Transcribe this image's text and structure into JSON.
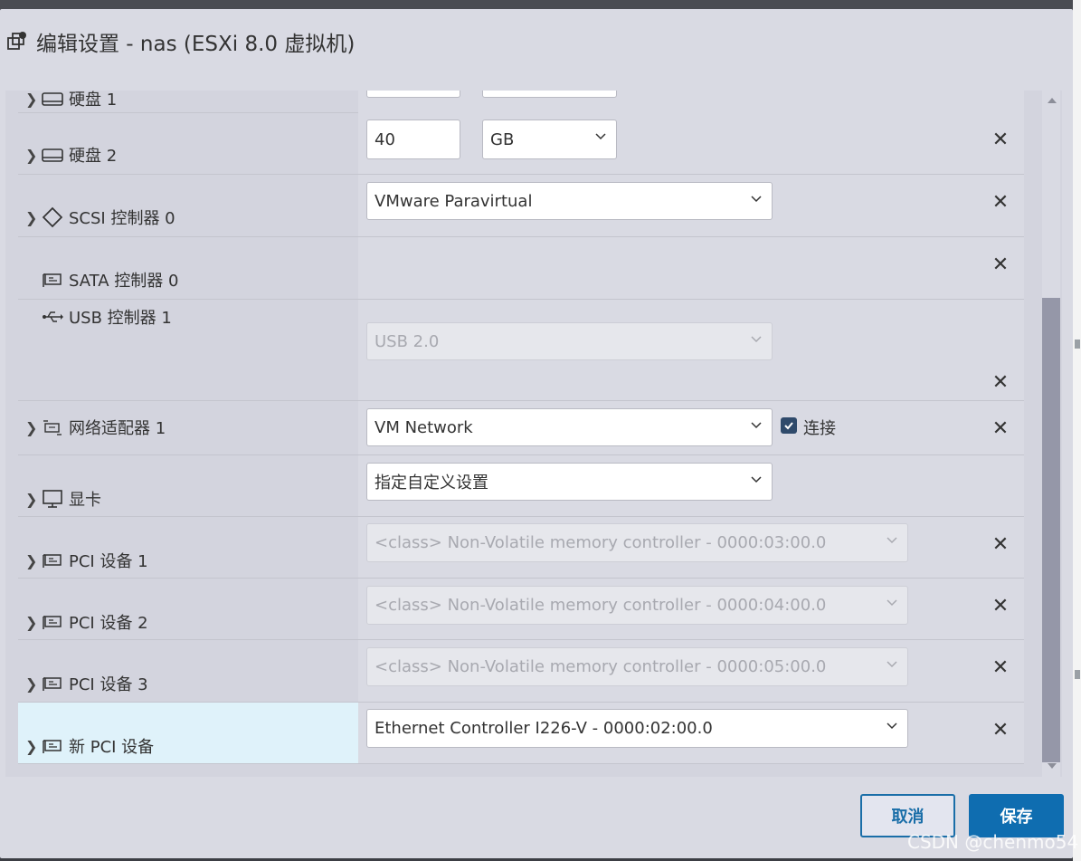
{
  "dialog": {
    "title": "编辑设置 - nas (ESXi 8.0 虚拟机)"
  },
  "devices": [
    {
      "label": "硬盘 1"
    },
    {
      "label": "硬盘 2",
      "size_value": "40",
      "unit": "GB"
    },
    {
      "label": "SCSI 控制器 0",
      "value": "VMware Paravirtual"
    },
    {
      "label": "SATA 控制器 0"
    },
    {
      "label": "USB 控制器 1",
      "value": "USB 2.0"
    },
    {
      "label": "网络适配器 1",
      "value": "VM Network",
      "connect_label": "连接",
      "connected": true
    },
    {
      "label": "显卡",
      "value": "指定自定义设置"
    },
    {
      "label": "PCI 设备 1",
      "value": "<class> Non-Volatile memory controller - 0000:03:00.0"
    },
    {
      "label": "PCI 设备 2",
      "value": "<class> Non-Volatile memory controller - 0000:04:00.0"
    },
    {
      "label": "PCI 设备 3",
      "value": "<class> Non-Volatile memory controller - 0000:05:00.0"
    },
    {
      "label": "新 PCI 设备",
      "value": "Ethernet Controller I226-V - 0000:02:00.0"
    }
  ],
  "footer": {
    "cancel_label": "取消",
    "save_label": "保存"
  },
  "watermark": "CSDN @chenmo54",
  "colors": {
    "primary": "#0f6db0",
    "highlight_row": "#dff2fa",
    "checkbox": "#2f4a6b"
  }
}
